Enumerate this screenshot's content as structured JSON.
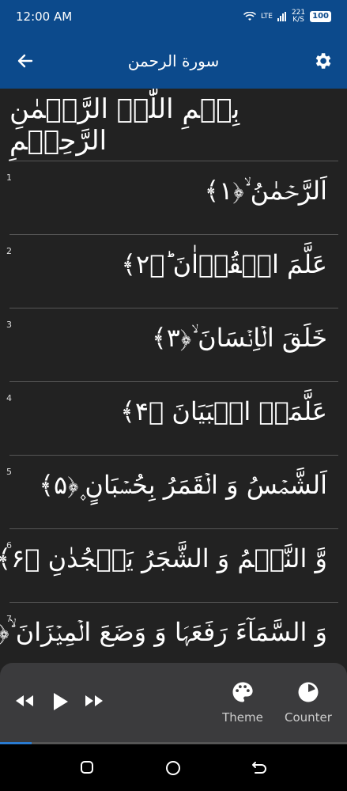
{
  "status": {
    "time": "12:00 AM",
    "net_type": "LTE",
    "net_speed_value": "221",
    "net_speed_unit": "K/S",
    "battery": "100"
  },
  "appbar": {
    "title": "سورة الرحمن",
    "back_icon": "arrow-left-icon",
    "settings_icon": "gear-icon"
  },
  "bismillah": "بِسۡمِ اللّٰہِ الرَّحۡمٰنِ الرَّحِیۡمِ",
  "verses": [
    {
      "num": "1",
      "text": "اَلرَّحۡمٰنُ ۙ﴿۱﴾"
    },
    {
      "num": "2",
      "text": "عَلَّمَ الۡقُرۡاٰنَ ؕ﴿۲﴾"
    },
    {
      "num": "3",
      "text": "خَلَقَ الۡاِنۡسَانَ ۙ﴿۳﴾"
    },
    {
      "num": "4",
      "text": "عَلَّمَہُ الۡبَیَانَ ﴿۴﴾"
    },
    {
      "num": "5",
      "text": "اَلشَّمۡسُ وَ الۡقَمَرُ بِحُسۡبَانٍ ۪﴿۵﴾"
    },
    {
      "num": "6",
      "text": "وَّ النَّجۡمُ وَ الشَّجَرُ یَسۡجُدٰنِ ﴿۶﴾"
    },
    {
      "num": "7",
      "text": "وَ السَّمَآءَ رَفَعَہَا وَ وَضَعَ الۡمِیۡزَانَ ۙ﴿۷﴾"
    }
  ],
  "player": {
    "theme_label": "Theme",
    "counter_label": "Counter",
    "progress": 0.09
  }
}
